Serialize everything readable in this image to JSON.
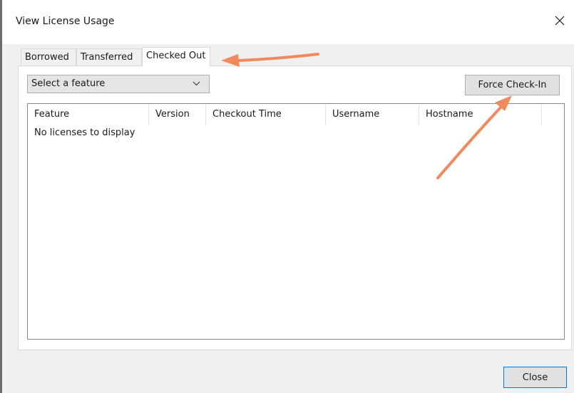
{
  "window": {
    "title": "View License Usage",
    "close_glyph": "✕"
  },
  "tabs": [
    {
      "label": "Borrowed",
      "active": false
    },
    {
      "label": "Transferred",
      "active": false
    },
    {
      "label": "Checked Out",
      "active": true
    }
  ],
  "feature_select": {
    "value": "Select a feature",
    "icon": "chevron-down-icon"
  },
  "toolbar": {
    "force_checkin_label": "Force Check-In"
  },
  "table": {
    "columns": [
      "Feature",
      "Version",
      "Checkout Time",
      "Username",
      "Hostname"
    ],
    "empty_message": "No licenses to display"
  },
  "footer": {
    "close_label": "Close"
  },
  "annotations": {
    "arrow_color": "#f08a5d"
  },
  "colors": {
    "focus_border": "#0078d7",
    "button_face": "#e1e1e1",
    "dialog_background": "#f0f0f0"
  }
}
